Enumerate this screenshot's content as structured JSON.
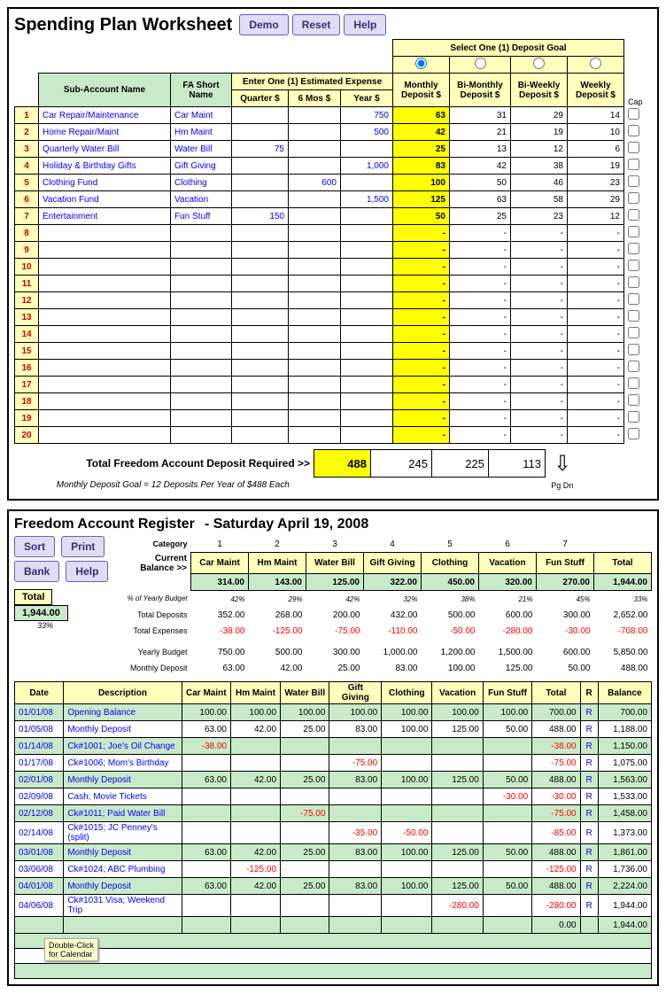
{
  "worksheet": {
    "title": "Spending Plan Worksheet",
    "buttons": {
      "demo": "Demo",
      "reset": "Reset",
      "help": "Help"
    },
    "select_goal_hdr": "Select One (1) Deposit Goal",
    "headers": {
      "sub_account": "Sub-Account Name",
      "fa_short": "FA Short Name",
      "enter_expense": "Enter One (1) Estimated Expense",
      "quarter": "Quarter $",
      "sixmos": "6 Mos $",
      "year": "Year $",
      "monthly": "Monthly Deposit $",
      "bimonthly": "Bi-Monthly Deposit $",
      "biweekly": "Bi-Weekly Deposit $",
      "weekly": "Weekly Deposit $",
      "cap": "Cap"
    },
    "rows": [
      {
        "n": 1,
        "name": "Car Repair/Maintenance",
        "short": "Car Maint",
        "q": "",
        "m6": "",
        "yr": "750",
        "mo": "63",
        "bm": "31",
        "bw": "29",
        "wk": "14"
      },
      {
        "n": 2,
        "name": "Home Repair/Maint",
        "short": "Hm Maint",
        "q": "",
        "m6": "",
        "yr": "500",
        "mo": "42",
        "bm": "21",
        "bw": "19",
        "wk": "10"
      },
      {
        "n": 3,
        "name": "Quarterly Water Bill",
        "short": "Water Bill",
        "q": "75",
        "m6": "",
        "yr": "",
        "mo": "25",
        "bm": "13",
        "bw": "12",
        "wk": "6"
      },
      {
        "n": 4,
        "name": "Holiday & Birthday Gifts",
        "short": "Gift Giving",
        "q": "",
        "m6": "",
        "yr": "1,000",
        "mo": "83",
        "bm": "42",
        "bw": "38",
        "wk": "19"
      },
      {
        "n": 5,
        "name": "Clothing Fund",
        "short": "Clothing",
        "q": "",
        "m6": "600",
        "yr": "",
        "mo": "100",
        "bm": "50",
        "bw": "46",
        "wk": "23"
      },
      {
        "n": 6,
        "name": "Vacation Fund",
        "short": "Vacation",
        "q": "",
        "m6": "",
        "yr": "1,500",
        "mo": "125",
        "bm": "63",
        "bw": "58",
        "wk": "29"
      },
      {
        "n": 7,
        "name": "Entertainment",
        "short": "Fun Stuff",
        "q": "150",
        "m6": "",
        "yr": "",
        "mo": "50",
        "bm": "25",
        "bw": "23",
        "wk": "12"
      },
      {
        "n": 8,
        "name": "",
        "short": "",
        "q": "",
        "m6": "",
        "yr": "",
        "mo": "-",
        "bm": "-",
        "bw": "-",
        "wk": "-"
      },
      {
        "n": 9,
        "name": "",
        "short": "",
        "q": "",
        "m6": "",
        "yr": "",
        "mo": "-",
        "bm": "-",
        "bw": "-",
        "wk": "-"
      },
      {
        "n": 10,
        "name": "",
        "short": "",
        "q": "",
        "m6": "",
        "yr": "",
        "mo": "-",
        "bm": "-",
        "bw": "-",
        "wk": "-"
      },
      {
        "n": 11,
        "name": "",
        "short": "",
        "q": "",
        "m6": "",
        "yr": "",
        "mo": "-",
        "bm": "-",
        "bw": "-",
        "wk": "-"
      },
      {
        "n": 12,
        "name": "",
        "short": "",
        "q": "",
        "m6": "",
        "yr": "",
        "mo": "-",
        "bm": "-",
        "bw": "-",
        "wk": "-"
      },
      {
        "n": 13,
        "name": "",
        "short": "",
        "q": "",
        "m6": "",
        "yr": "",
        "mo": "-",
        "bm": "-",
        "bw": "-",
        "wk": "-"
      },
      {
        "n": 14,
        "name": "",
        "short": "",
        "q": "",
        "m6": "",
        "yr": "",
        "mo": "-",
        "bm": "-",
        "bw": "-",
        "wk": "-"
      },
      {
        "n": 15,
        "name": "",
        "short": "",
        "q": "",
        "m6": "",
        "yr": "",
        "mo": "-",
        "bm": "-",
        "bw": "-",
        "wk": "-"
      },
      {
        "n": 16,
        "name": "",
        "short": "",
        "q": "",
        "m6": "",
        "yr": "",
        "mo": "-",
        "bm": "-",
        "bw": "-",
        "wk": "-"
      },
      {
        "n": 17,
        "name": "",
        "short": "",
        "q": "",
        "m6": "",
        "yr": "",
        "mo": "-",
        "bm": "-",
        "bw": "-",
        "wk": "-"
      },
      {
        "n": 18,
        "name": "",
        "short": "",
        "q": "",
        "m6": "",
        "yr": "",
        "mo": "-",
        "bm": "-",
        "bw": "-",
        "wk": "-"
      },
      {
        "n": 19,
        "name": "",
        "short": "",
        "q": "",
        "m6": "",
        "yr": "",
        "mo": "-",
        "bm": "-",
        "bw": "-",
        "wk": "-"
      },
      {
        "n": 20,
        "name": "",
        "short": "",
        "q": "",
        "m6": "",
        "yr": "",
        "mo": "-",
        "bm": "-",
        "bw": "-",
        "wk": "-"
      }
    ],
    "total_label": "Total Freedom Account Deposit Required  >>",
    "totals": {
      "mo": "488",
      "bm": "245",
      "bw": "225",
      "wk": "113"
    },
    "monthly_note": "Monthly Deposit Goal = 12 Deposits Per Year of $488 Each",
    "pgdn": "Pg Dn"
  },
  "register": {
    "title": "Freedom Account Register",
    "date_title": "Saturday April 19, 2008",
    "buttons": {
      "sort": "Sort",
      "print": "Print",
      "bank": "Bank",
      "help": "Help"
    },
    "total_label": "Total",
    "total_value": "1,944.00",
    "total_pct": "33%",
    "summary_labels": {
      "category": "Category",
      "curbal": "Current Balance >>",
      "pct": "% of Yearly Budget",
      "totdep": "Total Deposits",
      "totexp": "Total Expenses",
      "yb": "Yearly Budget",
      "md": "Monthly Deposit"
    },
    "cat_nums": [
      "1",
      "2",
      "3",
      "4",
      "5",
      "6",
      "7",
      ""
    ],
    "cats": [
      "Car Maint",
      "Hm Maint",
      "Water Bill",
      "Gift Giving",
      "Clothing",
      "Vacation",
      "Fun Stuff",
      "Total"
    ],
    "curbal": [
      "314.00",
      "143.00",
      "125.00",
      "322.00",
      "450.00",
      "320.00",
      "270.00",
      "1,944.00"
    ],
    "pct": [
      "42%",
      "29%",
      "42%",
      "32%",
      "38%",
      "21%",
      "45%",
      "33%"
    ],
    "totdep": [
      "352.00",
      "268.00",
      "200.00",
      "432.00",
      "500.00",
      "600.00",
      "300.00",
      "2,652.00"
    ],
    "totexp": [
      "-38.00",
      "-125.00",
      "-75.00",
      "-110.00",
      "-50.00",
      "-280.00",
      "-30.00",
      "-708.00"
    ],
    "yb": [
      "750.00",
      "500.00",
      "300.00",
      "1,000.00",
      "1,200.00",
      "1,500.00",
      "600.00",
      "5,850.00"
    ],
    "md": [
      "63.00",
      "42.00",
      "25.00",
      "83.00",
      "100.00",
      "125.00",
      "50.00",
      "488.00"
    ],
    "tx_headers": {
      "date": "Date",
      "desc": "Description",
      "c1": "Car Maint",
      "c2": "Hm Maint",
      "c3": "Water Bill",
      "c4": "Gift Giving",
      "c5": "Clothing",
      "c6": "Vacation",
      "c7": "Fun Stuff",
      "total": "Total",
      "r": "R",
      "bal": "Balance"
    },
    "tx": [
      {
        "d": "01/01/08",
        "desc": "Opening Balance",
        "v": [
          "100.00",
          "100.00",
          "100.00",
          "100.00",
          "100.00",
          "100.00",
          "100.00"
        ],
        "t": "700.00",
        "r": "R",
        "b": "700.00",
        "green": true
      },
      {
        "d": "01/05/08",
        "desc": "Monthly Deposit",
        "v": [
          "63.00",
          "42.00",
          "25.00",
          "83.00",
          "100.00",
          "125.00",
          "50.00"
        ],
        "t": "488.00",
        "r": "R",
        "b": "1,188.00",
        "green": false
      },
      {
        "d": "01/14/08",
        "desc": "Ck#1001; Joe's Oil Change",
        "v": [
          "-38.00",
          "",
          "",
          "",
          "",
          "",
          ""
        ],
        "t": "-38.00",
        "r": "R",
        "b": "1,150.00",
        "green": true,
        "neg": [
          0
        ],
        "tneg": true
      },
      {
        "d": "01/17/08",
        "desc": "Ck#1006; Mom's Birthday",
        "v": [
          "",
          "",
          "",
          "-75.00",
          "",
          "",
          ""
        ],
        "t": "-75.00",
        "r": "R",
        "b": "1,075.00",
        "green": false,
        "neg": [
          3
        ],
        "tneg": true
      },
      {
        "d": "02/01/08",
        "desc": "Monthly Deposit",
        "v": [
          "63.00",
          "42.00",
          "25.00",
          "83.00",
          "100.00",
          "125.00",
          "50.00"
        ],
        "t": "488.00",
        "r": "R",
        "b": "1,563.00",
        "green": true
      },
      {
        "d": "02/09/08",
        "desc": "Cash; Movie Tickets",
        "v": [
          "",
          "",
          "",
          "",
          "",
          "",
          "-30.00"
        ],
        "t": "-30.00",
        "r": "R",
        "b": "1,533.00",
        "green": false,
        "neg": [
          6
        ],
        "tneg": true
      },
      {
        "d": "02/12/08",
        "desc": "Ck#1011; Paid Water Bill",
        "v": [
          "",
          "",
          "-75.00",
          "",
          "",
          "",
          ""
        ],
        "t": "-75.00",
        "r": "R",
        "b": "1,458.00",
        "green": true,
        "neg": [
          2
        ],
        "tneg": true
      },
      {
        "d": "02/14/08",
        "desc": "Ck#1015; JC Penney's (split)",
        "v": [
          "",
          "",
          "",
          "-35.00",
          "-50.00",
          "",
          ""
        ],
        "t": "-85.00",
        "r": "R",
        "b": "1,373.00",
        "green": false,
        "neg": [
          3,
          4
        ],
        "tneg": true
      },
      {
        "d": "03/01/08",
        "desc": "Monthly Deposit",
        "v": [
          "63.00",
          "42.00",
          "25.00",
          "83.00",
          "100.00",
          "125.00",
          "50.00"
        ],
        "t": "488.00",
        "r": "R",
        "b": "1,861.00",
        "green": true
      },
      {
        "d": "03/06/08",
        "desc": "Ck#1024; ABC Plumbing",
        "v": [
          "",
          "-125.00",
          "",
          "",
          "",
          "",
          ""
        ],
        "t": "-125.00",
        "r": "R",
        "b": "1,736.00",
        "green": false,
        "neg": [
          1
        ],
        "tneg": true
      },
      {
        "d": "04/01/08",
        "desc": "Monthly Deposit",
        "v": [
          "63.00",
          "42.00",
          "25.00",
          "83.00",
          "100.00",
          "125.00",
          "50.00"
        ],
        "t": "488.00",
        "r": "R",
        "b": "2,224.00",
        "green": true
      },
      {
        "d": "04/06/08",
        "desc": "Ck#1031 Visa; Weekend Trip",
        "v": [
          "",
          "",
          "",
          "",
          "",
          "-280.00",
          ""
        ],
        "t": "-280.00",
        "r": "R",
        "b": "1,944.00",
        "green": false,
        "neg": [
          5
        ],
        "tneg": true
      },
      {
        "d": "",
        "desc": "",
        "v": [
          "",
          "",
          "",
          "",
          "",
          "",
          ""
        ],
        "t": "0.00",
        "r": "",
        "b": "1,944.00",
        "green": true
      }
    ],
    "tooltip1": "Double-Click",
    "tooltip2": "for Calendar"
  }
}
